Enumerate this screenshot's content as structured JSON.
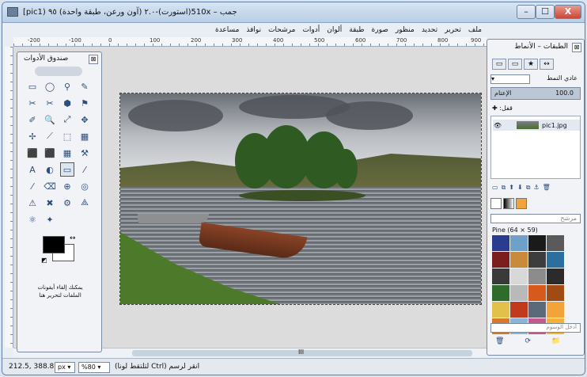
{
  "window": {
    "title": "جمب – 510x(استورت)-٢.٠ (آون ورعن، طبقة واحدة) ٩٥ (pic1]",
    "min_label": "–",
    "max_label": "☐",
    "close_label": "X"
  },
  "menubar": {
    "items": [
      "ملف",
      "تحرير",
      "تحديد",
      "منظور",
      "صورة",
      "طبقة",
      "ألوان",
      "أدوات",
      "مرشحات",
      "نوافذ",
      "مساعدة"
    ]
  },
  "ruler": {
    "ticks": [
      "-200",
      "-100",
      "0",
      "100",
      "200",
      "300",
      "400",
      "500",
      "600",
      "700",
      "800",
      "900"
    ]
  },
  "toolbox": {
    "title": "صندوق الأدوات",
    "close_label": "⊠",
    "tools": [
      "▭",
      "◯",
      "⚲",
      "✎",
      "✂",
      "✂",
      "⬢",
      "⚑",
      "✐",
      "🔍",
      "⤢",
      "✥",
      "✢",
      "⟋",
      "⬚",
      "▦",
      "⬛",
      "⬛",
      "▦",
      "⚒",
      "A",
      "◐",
      "▭",
      "⁄",
      "⁄",
      "⌫",
      "⊕",
      "◎",
      "⚠",
      "✖",
      "⚙",
      "⟁",
      "⚛",
      "✦"
    ],
    "selected_tool_index": 22,
    "hint": "يمكنك إلقاء أيقونات الملفات لتحرير هنا"
  },
  "status": {
    "coords": "212.5, 388.8",
    "unit": "px ▾",
    "zoom": "%80 ▾",
    "message": "انقر لرسم (Ctrl لتلتقط لونا)"
  },
  "hscroll": {
    "label": "III"
  },
  "dock": {
    "title": "الطبقات – الأنماط",
    "close_label": "⊠",
    "tabs": [
      "▭",
      "▭",
      "★",
      "↔"
    ],
    "mode_label": "عادي النمط",
    "mode_value": "▾",
    "opacity_label": "الإعتام",
    "opacity_value": "100.0",
    "lock_label": "قفل: ✚",
    "layers": [
      {
        "name": "pic1.jpg",
        "visible_icon": "👁"
      }
    ],
    "layer_buttons": [
      "▭",
      "⧉",
      "⬆",
      "⬇",
      "⧉",
      "⚓",
      "🗑"
    ],
    "brush_filter": "مرشح",
    "brush_name": "Pine (64 × 59)",
    "brush_tags": "أدخل الوسوم",
    "brush_buttons": [
      "🗑",
      "⟳",
      "📁"
    ],
    "swatches": [
      "#2a3c8f",
      "#6fa0c8",
      "#1a1a1a",
      "#5a5a5a",
      "#7a1e1e",
      "#c98a3c",
      "#3d3d3d",
      "#2b6fa0",
      "#3a3a3a",
      "#d8d8d8",
      "#8c8c8c",
      "#2b2b2b",
      "#2f6b2a",
      "#b9b9b9",
      "#d65a1e",
      "#a04a14",
      "#e2c14a",
      "#c03a1e",
      "#5a6a7a",
      "#f2a43a",
      "#d47a2a",
      "#8ab4d8",
      "#c35a8a",
      "#f2b13a"
    ]
  }
}
